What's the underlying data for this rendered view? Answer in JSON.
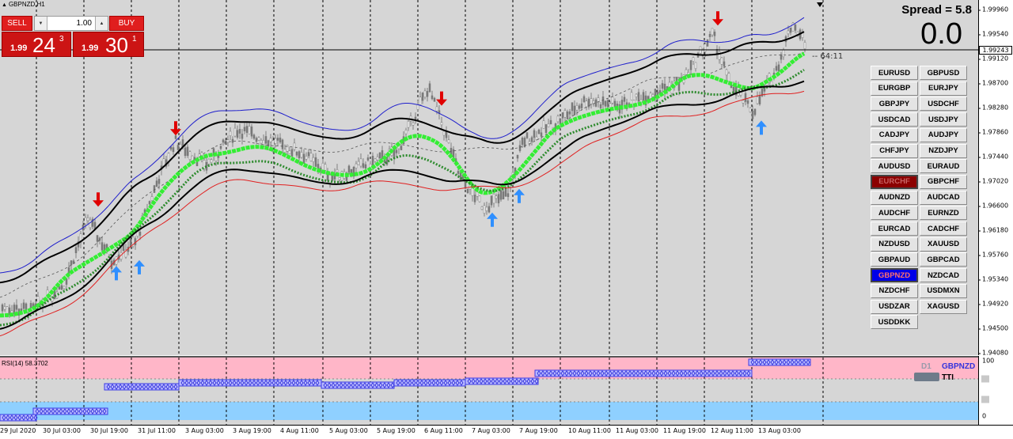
{
  "chart": {
    "symbol_title": "GBPNZD,H1",
    "spread_label": "Spread = 5.8",
    "spread_value": "0.0",
    "countdown": "-- 64:11",
    "current_price": "1.99243"
  },
  "trade_panel": {
    "sell_label": "SELL",
    "buy_label": "BUY",
    "lot_value": "1.00",
    "sell_quote": {
      "prefix": "1.99",
      "big": "24",
      "sup": "3"
    },
    "buy_quote": {
      "prefix": "1.99",
      "big": "30",
      "sup": "1"
    }
  },
  "symbols": [
    "EURUSD",
    "GBPUSD",
    "EURGBP",
    "EURJPY",
    "GBPJPY",
    "USDCHF",
    "USDCAD",
    "USDJPY",
    "CADJPY",
    "AUDJPY",
    "CHFJPY",
    "NZDJPY",
    "AUDUSD",
    "EURAUD",
    "EURCHF",
    "GBPCHF",
    "AUDNZD",
    "AUDCAD",
    "AUDCHF",
    "EURNZD",
    "EURCAD",
    "CADCHF",
    "NZDUSD",
    "XAUUSD",
    "GBPAUD",
    "GBPCAD",
    "GBPNZD",
    "NZDCAD",
    "NZDCHF",
    "USDMXN",
    "USDZAR",
    "XAGUSD",
    "USDDKK"
  ],
  "selected_symbols": {
    "red": "EURCHF",
    "blue": "GBPNZD"
  },
  "price_axis": [
    "1.99960",
    "1.99540",
    "1.99120",
    "1.98700",
    "1.98280",
    "1.97860",
    "1.97440",
    "1.97020",
    "1.96600",
    "1.96180",
    "1.95760",
    "1.95340",
    "1.94920",
    "1.94500",
    "1.94080"
  ],
  "time_axis": [
    "29 Jul 2020",
    "30 Jul 03:00",
    "30 Jul 19:00",
    "31 Jul 11:00",
    "3 Aug 03:00",
    "3 Aug 19:00",
    "4 Aug 11:00",
    "5 Aug 03:00",
    "5 Aug 19:00",
    "6 Aug 11:00",
    "7 Aug 03:00",
    "7 Aug 19:00",
    "10 Aug 11:00",
    "11 Aug 03:00",
    "11 Aug 19:00",
    "12 Aug 11:00",
    "13 Aug 03:00"
  ],
  "rsi_panel": {
    "label": "RSI(14) 58.3702",
    "tti_timeframe": "D1",
    "tti_pair": "GBPNZD",
    "tti_label": "TTI",
    "ticks": [
      "100",
      "0"
    ]
  },
  "colors": {
    "background": "#d6d6d6",
    "candle": "#7a7a7a",
    "green_band": "#33ee33",
    "dark_green": "#2e8b2e",
    "black_band": "#000000",
    "blue_band": "#1e1ecc",
    "red_band": "#e02020",
    "arrow_down": "#e00000",
    "arrow_up": "#2f8fff",
    "rsi_pink": "#ffb6c8",
    "rsi_blue": "#8fd0ff"
  },
  "chart_data": {
    "type": "candlestick",
    "title": "GBPNZD,H1",
    "ylim": [
      1.94,
      1.9998
    ],
    "series": [
      {
        "name": "price",
        "x": [
          0,
          40,
          80,
          110,
          140,
          170,
          200,
          220,
          260,
          300,
          340,
          380,
          420,
          460,
          500,
          540,
          560,
          580,
          610,
          640,
          660,
          700,
          740,
          780,
          820,
          860,
          900,
          920,
          950,
          980,
          1000,
          1018
        ],
        "values": [
          1.948,
          1.9475,
          1.952,
          1.963,
          1.956,
          1.959,
          1.97,
          1.976,
          1.972,
          1.978,
          1.976,
          1.974,
          1.97,
          1.972,
          1.974,
          1.985,
          1.978,
          1.97,
          1.965,
          1.967,
          1.976,
          1.979,
          1.983,
          1.982,
          1.984,
          1.986,
          1.994,
          1.986,
          1.981,
          1.988,
          1.996,
          1.9924
        ]
      }
    ],
    "signals": [
      {
        "type": "down",
        "x": 124,
        "y": 1.965
      },
      {
        "type": "up",
        "x": 147,
        "y": 1.955
      },
      {
        "type": "up",
        "x": 176,
        "y": 1.956
      },
      {
        "type": "down",
        "x": 222,
        "y": 1.977
      },
      {
        "type": "down",
        "x": 558,
        "y": 1.982
      },
      {
        "type": "up",
        "x": 622,
        "y": 1.964
      },
      {
        "type": "up",
        "x": 656,
        "y": 1.968
      },
      {
        "type": "down",
        "x": 907,
        "y": 1.9955
      },
      {
        "type": "up",
        "x": 962,
        "y": 1.9795
      }
    ]
  }
}
